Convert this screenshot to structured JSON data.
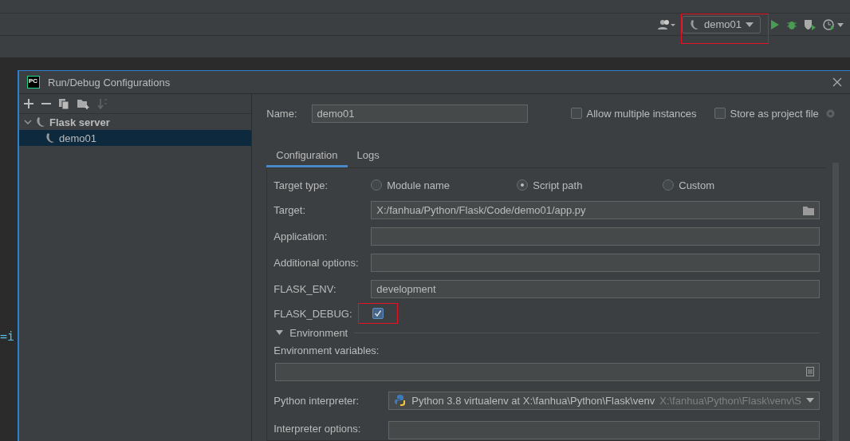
{
  "ide": {
    "run_config": {
      "label": "demo01",
      "highlighted": true
    },
    "editor_fragment": "=i"
  },
  "dialog": {
    "title": "Run/Debug Configurations",
    "logo": "PC",
    "tree": [
      {
        "label": "Flask server",
        "expanded": true,
        "selected": false,
        "children": [
          {
            "label": "demo01",
            "selected": true
          }
        ]
      }
    ],
    "name": {
      "label": "Name:",
      "value": "demo01"
    },
    "options": [
      {
        "label": "Allow multiple instances",
        "checked": false
      },
      {
        "label": "Store as project file",
        "checked": false
      }
    ],
    "tabs": [
      {
        "label": "Configuration",
        "selected": true
      },
      {
        "label": "Logs",
        "selected": false
      }
    ],
    "target_type": {
      "label": "Target type:",
      "choices": [
        {
          "label": "Module name",
          "selected": false
        },
        {
          "label": "Script path",
          "selected": true
        },
        {
          "label": "Custom",
          "selected": false
        }
      ]
    },
    "fields": [
      {
        "kind": "text",
        "label": "Target:",
        "value": "X:/fanhua/Python/Flask/Code/demo01/app.py",
        "browse": true
      },
      {
        "kind": "text",
        "label": "Application:"
      },
      {
        "kind": "text",
        "label": "Additional options:"
      },
      {
        "kind": "text",
        "label": "FLASK_ENV:",
        "value": "development"
      },
      {
        "kind": "checkbox",
        "label": "FLASK_DEBUG:",
        "checked": true,
        "highlighted": true
      }
    ],
    "environment": {
      "label": "Environment",
      "expanded": true,
      "variables_label": "Environment variables:"
    },
    "interpreter": {
      "label": "Python interpreter:",
      "value": "Python 3.8 virtualenv at X:\\fanhua\\Python\\Flask\\venv",
      "hint": "X:\\fanhua\\Python\\Flask\\venv\\S"
    },
    "interpreter_options": {
      "label": "Interpreter options:"
    }
  }
}
